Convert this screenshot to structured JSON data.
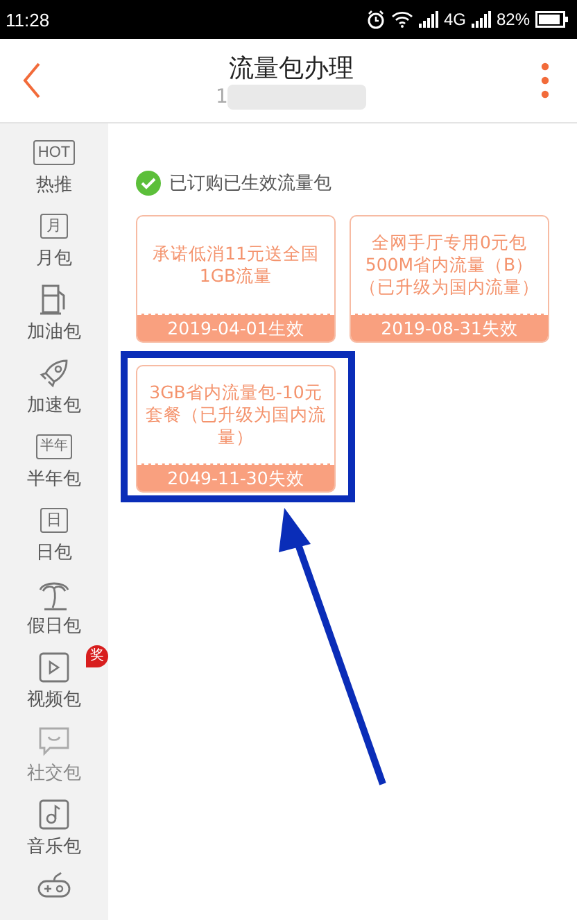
{
  "status_bar": {
    "time": "11:28",
    "network": "4G",
    "battery": "82%"
  },
  "header": {
    "title": "流量包办理",
    "subtitle": "1"
  },
  "sidebar": {
    "items": [
      {
        "label": "热推",
        "icon_text": "HOT"
      },
      {
        "label": "月包",
        "icon_text": "月"
      },
      {
        "label": "加油包"
      },
      {
        "label": "加速包"
      },
      {
        "label": "半年包",
        "icon_text": "半年"
      },
      {
        "label": "日包",
        "icon_text": "日"
      },
      {
        "label": "假日包"
      },
      {
        "label": "视频包",
        "badge": "奖"
      },
      {
        "label": "社交包"
      },
      {
        "label": "音乐包"
      }
    ]
  },
  "section_title": "已订购已生效流量包",
  "packages": [
    {
      "name": "承诺低消11元送全国1GB流量",
      "date": "2019-04-01生效",
      "highlighted": false
    },
    {
      "name": "全网手厅专用0元包500M省内流量（B）（已升级为国内流量）",
      "date": "2019-08-31失效",
      "highlighted": false
    },
    {
      "name": "3GB省内流量包-10元套餐（已升级为国内流量）",
      "date": "2049-11-30失效",
      "highlighted": true
    }
  ]
}
